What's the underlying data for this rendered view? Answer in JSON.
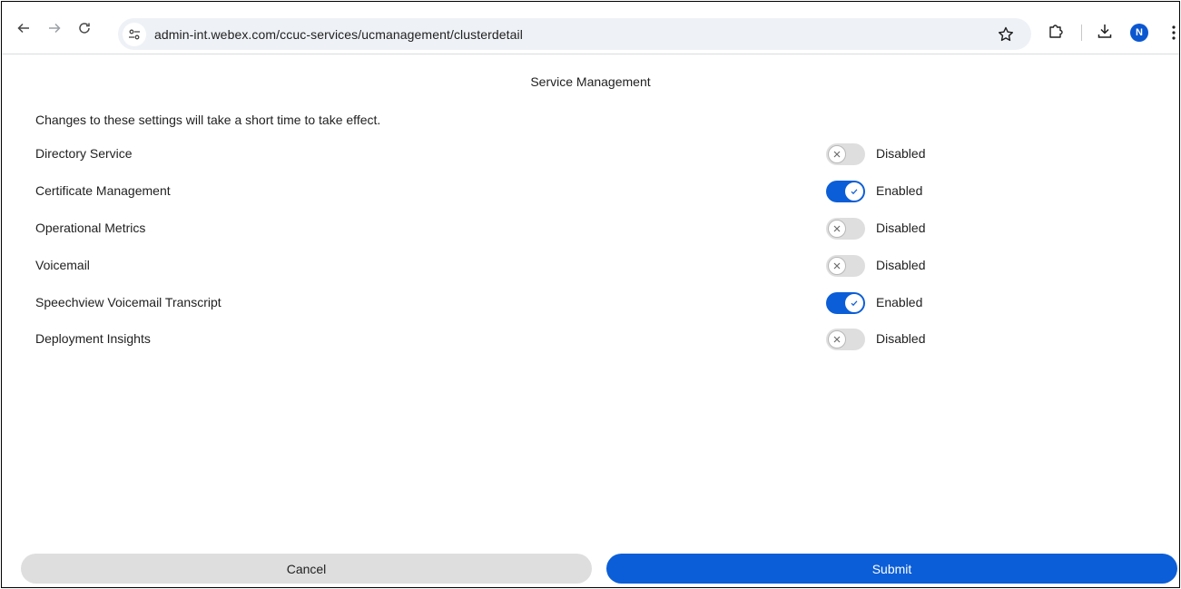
{
  "browser": {
    "url": "admin-int.webex.com/ccuc-services/ucmanagement/clusterdetail",
    "profile_initial": "N"
  },
  "page": {
    "title": "Service Management",
    "notice": "Changes to these settings will take a short time to take effect."
  },
  "services": [
    {
      "name": "Directory Service",
      "enabled": false,
      "state_label": "Disabled"
    },
    {
      "name": "Certificate Management",
      "enabled": true,
      "state_label": "Enabled"
    },
    {
      "name": "Operational Metrics",
      "enabled": false,
      "state_label": "Disabled"
    },
    {
      "name": "Voicemail",
      "enabled": false,
      "state_label": "Disabled"
    },
    {
      "name": "Speechview Voicemail Transcript",
      "enabled": true,
      "state_label": "Enabled"
    },
    {
      "name": "Deployment Insights",
      "enabled": false,
      "state_label": "Disabled"
    }
  ],
  "actions": {
    "cancel_label": "Cancel",
    "submit_label": "Submit"
  },
  "colors": {
    "accent": "#0b5ed7",
    "toggle_off": "#dedede",
    "avatar": "#0b57d0"
  },
  "icons": {
    "back": "arrow-left-icon",
    "forward": "arrow-right-icon",
    "reload": "reload-icon",
    "site_info": "tune-icon",
    "bookmark": "star-outline-icon",
    "extensions": "puzzle-icon",
    "downloads": "download-icon",
    "menu": "kebab-menu-icon",
    "toggle_on": "check-icon",
    "toggle_off": "x-icon"
  }
}
